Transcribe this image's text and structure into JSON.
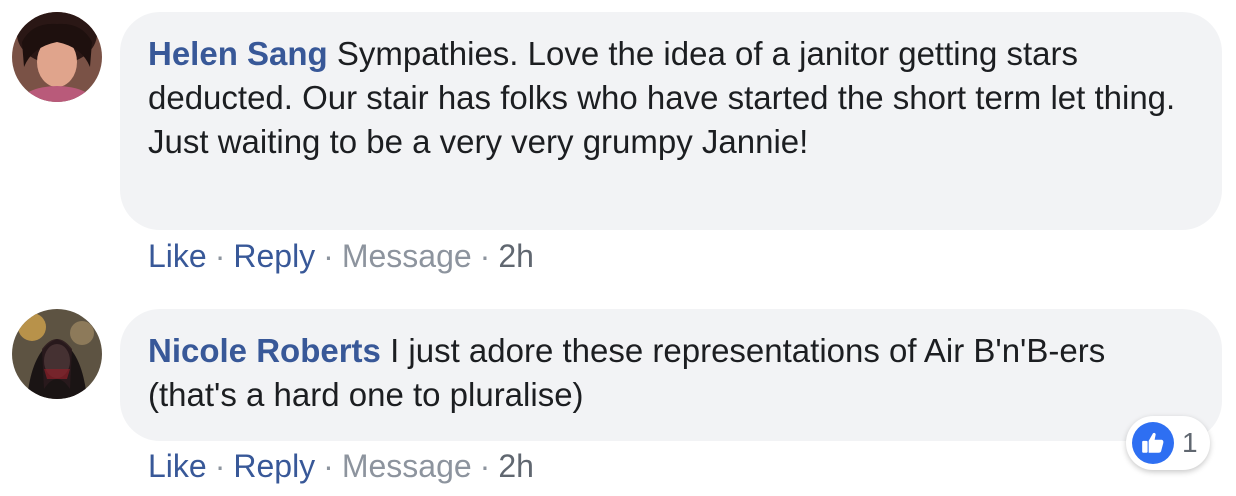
{
  "comments": [
    {
      "author": "Helen Sang",
      "text": "Sympathies. Love the idea of a janitor getting stars deducted. Our stair has folks who have started the short term let thing. Just waiting to be a very very grumpy Jannie!",
      "actions": {
        "like": "Like",
        "reply": "Reply",
        "message": "Message",
        "time": "2h"
      },
      "separator": "·"
    },
    {
      "author": "Nicole Roberts",
      "text": "I just adore these representations of Air B'n'B-ers (that's a hard one to pluralise)",
      "actions": {
        "like": "Like",
        "reply": "Reply",
        "message": "Message",
        "time": "2h"
      },
      "separator": "·",
      "reaction": {
        "icon": "like-thumb-icon",
        "count": "1",
        "color": "#2e6ff2"
      }
    }
  ],
  "colors": {
    "author_link": "#385898",
    "bubble_bg": "#f2f3f5",
    "muted": "#8d949e"
  }
}
